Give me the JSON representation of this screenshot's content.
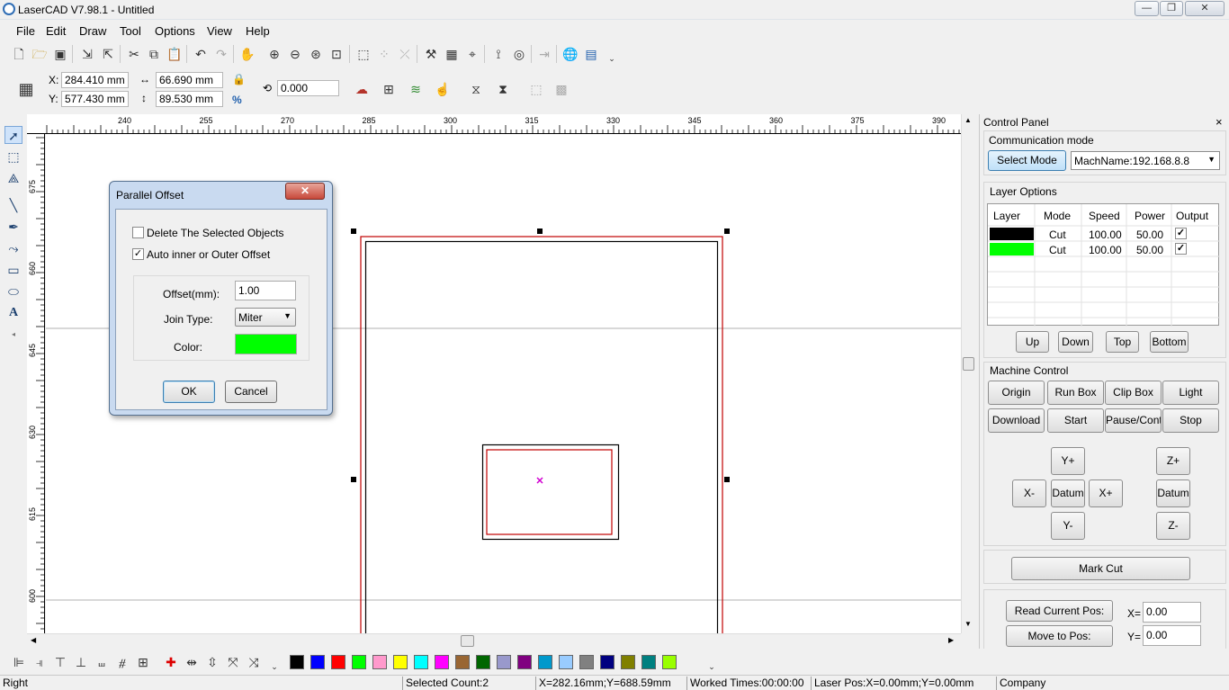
{
  "window": {
    "title": "LaserCAD V7.98.1 - Untitled",
    "controls": [
      "—",
      "❐",
      "✕"
    ]
  },
  "menu": [
    "File",
    "Edit",
    "Draw",
    "Tool",
    "Options",
    "View",
    "Help"
  ],
  "coords": {
    "x_label": "X:",
    "x_value": "284.410 mm",
    "y_label": "Y:",
    "y_value": "577.430 mm",
    "width_value": "66.690 mm",
    "height_value": "89.530 mm",
    "rotate_value": "0.000",
    "percent_label": "%"
  },
  "ruler": {
    "top": [
      "240",
      "255",
      "270",
      "285",
      "300",
      "315",
      "330",
      "345",
      "360",
      "375",
      "390"
    ],
    "left": [
      "675",
      "660",
      "645",
      "630",
      "615",
      "600"
    ]
  },
  "dialog": {
    "title": "Parallel Offset",
    "close": "✕",
    "delete_label": "Delete The Selected Objects",
    "delete_checked": "",
    "auto_label": "Auto inner or Outer Offset",
    "auto_checked": "✓",
    "offset_label": "Offset(mm):",
    "offset_value": "1.00",
    "join_label": "Join Type:",
    "join_value": "Miter",
    "color_label": "Color:",
    "color_value": "#00ff00",
    "ok": "OK",
    "cancel": "Cancel"
  },
  "panel": {
    "title": "Control Panel",
    "close": "×",
    "comm_label": "Communication mode",
    "select_mode": "Select Mode",
    "machine": "MachName:192.168.8.8",
    "layer_label": "Layer Options",
    "headers": [
      "Layer",
      "Mode",
      "Speed",
      "Power",
      "Output"
    ],
    "rows": [
      {
        "color": "#000000",
        "mode": "Cut",
        "speed": "100.00",
        "power": "50.00",
        "output": "✓"
      },
      {
        "color": "#00ff00",
        "mode": "Cut",
        "speed": "100.00",
        "power": "50.00",
        "output": "✓"
      }
    ],
    "order_buttons": [
      "Up",
      "Down",
      "Top",
      "Bottom"
    ],
    "machine_label": "Machine Control",
    "machine_buttons": [
      "Origin",
      "Run Box",
      "Clip Box",
      "Light",
      "Download",
      "Start",
      "Pause/Continue",
      "Stop"
    ],
    "jog": {
      "y_plus": "Y+",
      "x_minus": "X-",
      "datum": "Datum",
      "x_plus": "X+",
      "y_minus": "Y-",
      "z_plus": "Z+",
      "z_datum": "Datum",
      "z_minus": "Z-"
    },
    "mark_cut": "Mark Cut",
    "read_pos": "Read Current Pos:",
    "move_pos": "Move to Pos:",
    "x_label": "X=",
    "x_value": "0.00",
    "y_label": "Y=",
    "y_value": "0.00"
  },
  "palette": [
    "#000000",
    "#0000ff",
    "#ff0000",
    "#00ff00",
    "#ff99cc",
    "#ffff00",
    "#00ffff",
    "#ff00ff",
    "#996633",
    "#006600",
    "#9999cc",
    "#800080",
    "#0099cc",
    "#99ccff",
    "#808080",
    "#000080",
    "#808000",
    "#008080",
    "#99ff00"
  ],
  "status": {
    "mode": "Right",
    "selected": "Selected Count:2",
    "cursor": "X=282.16mm;Y=688.59mm",
    "worked": "Worked Times:00:00:00",
    "laser_pos": "Laser Pos:X=0.00mm;Y=0.00mm",
    "company": "Company"
  }
}
